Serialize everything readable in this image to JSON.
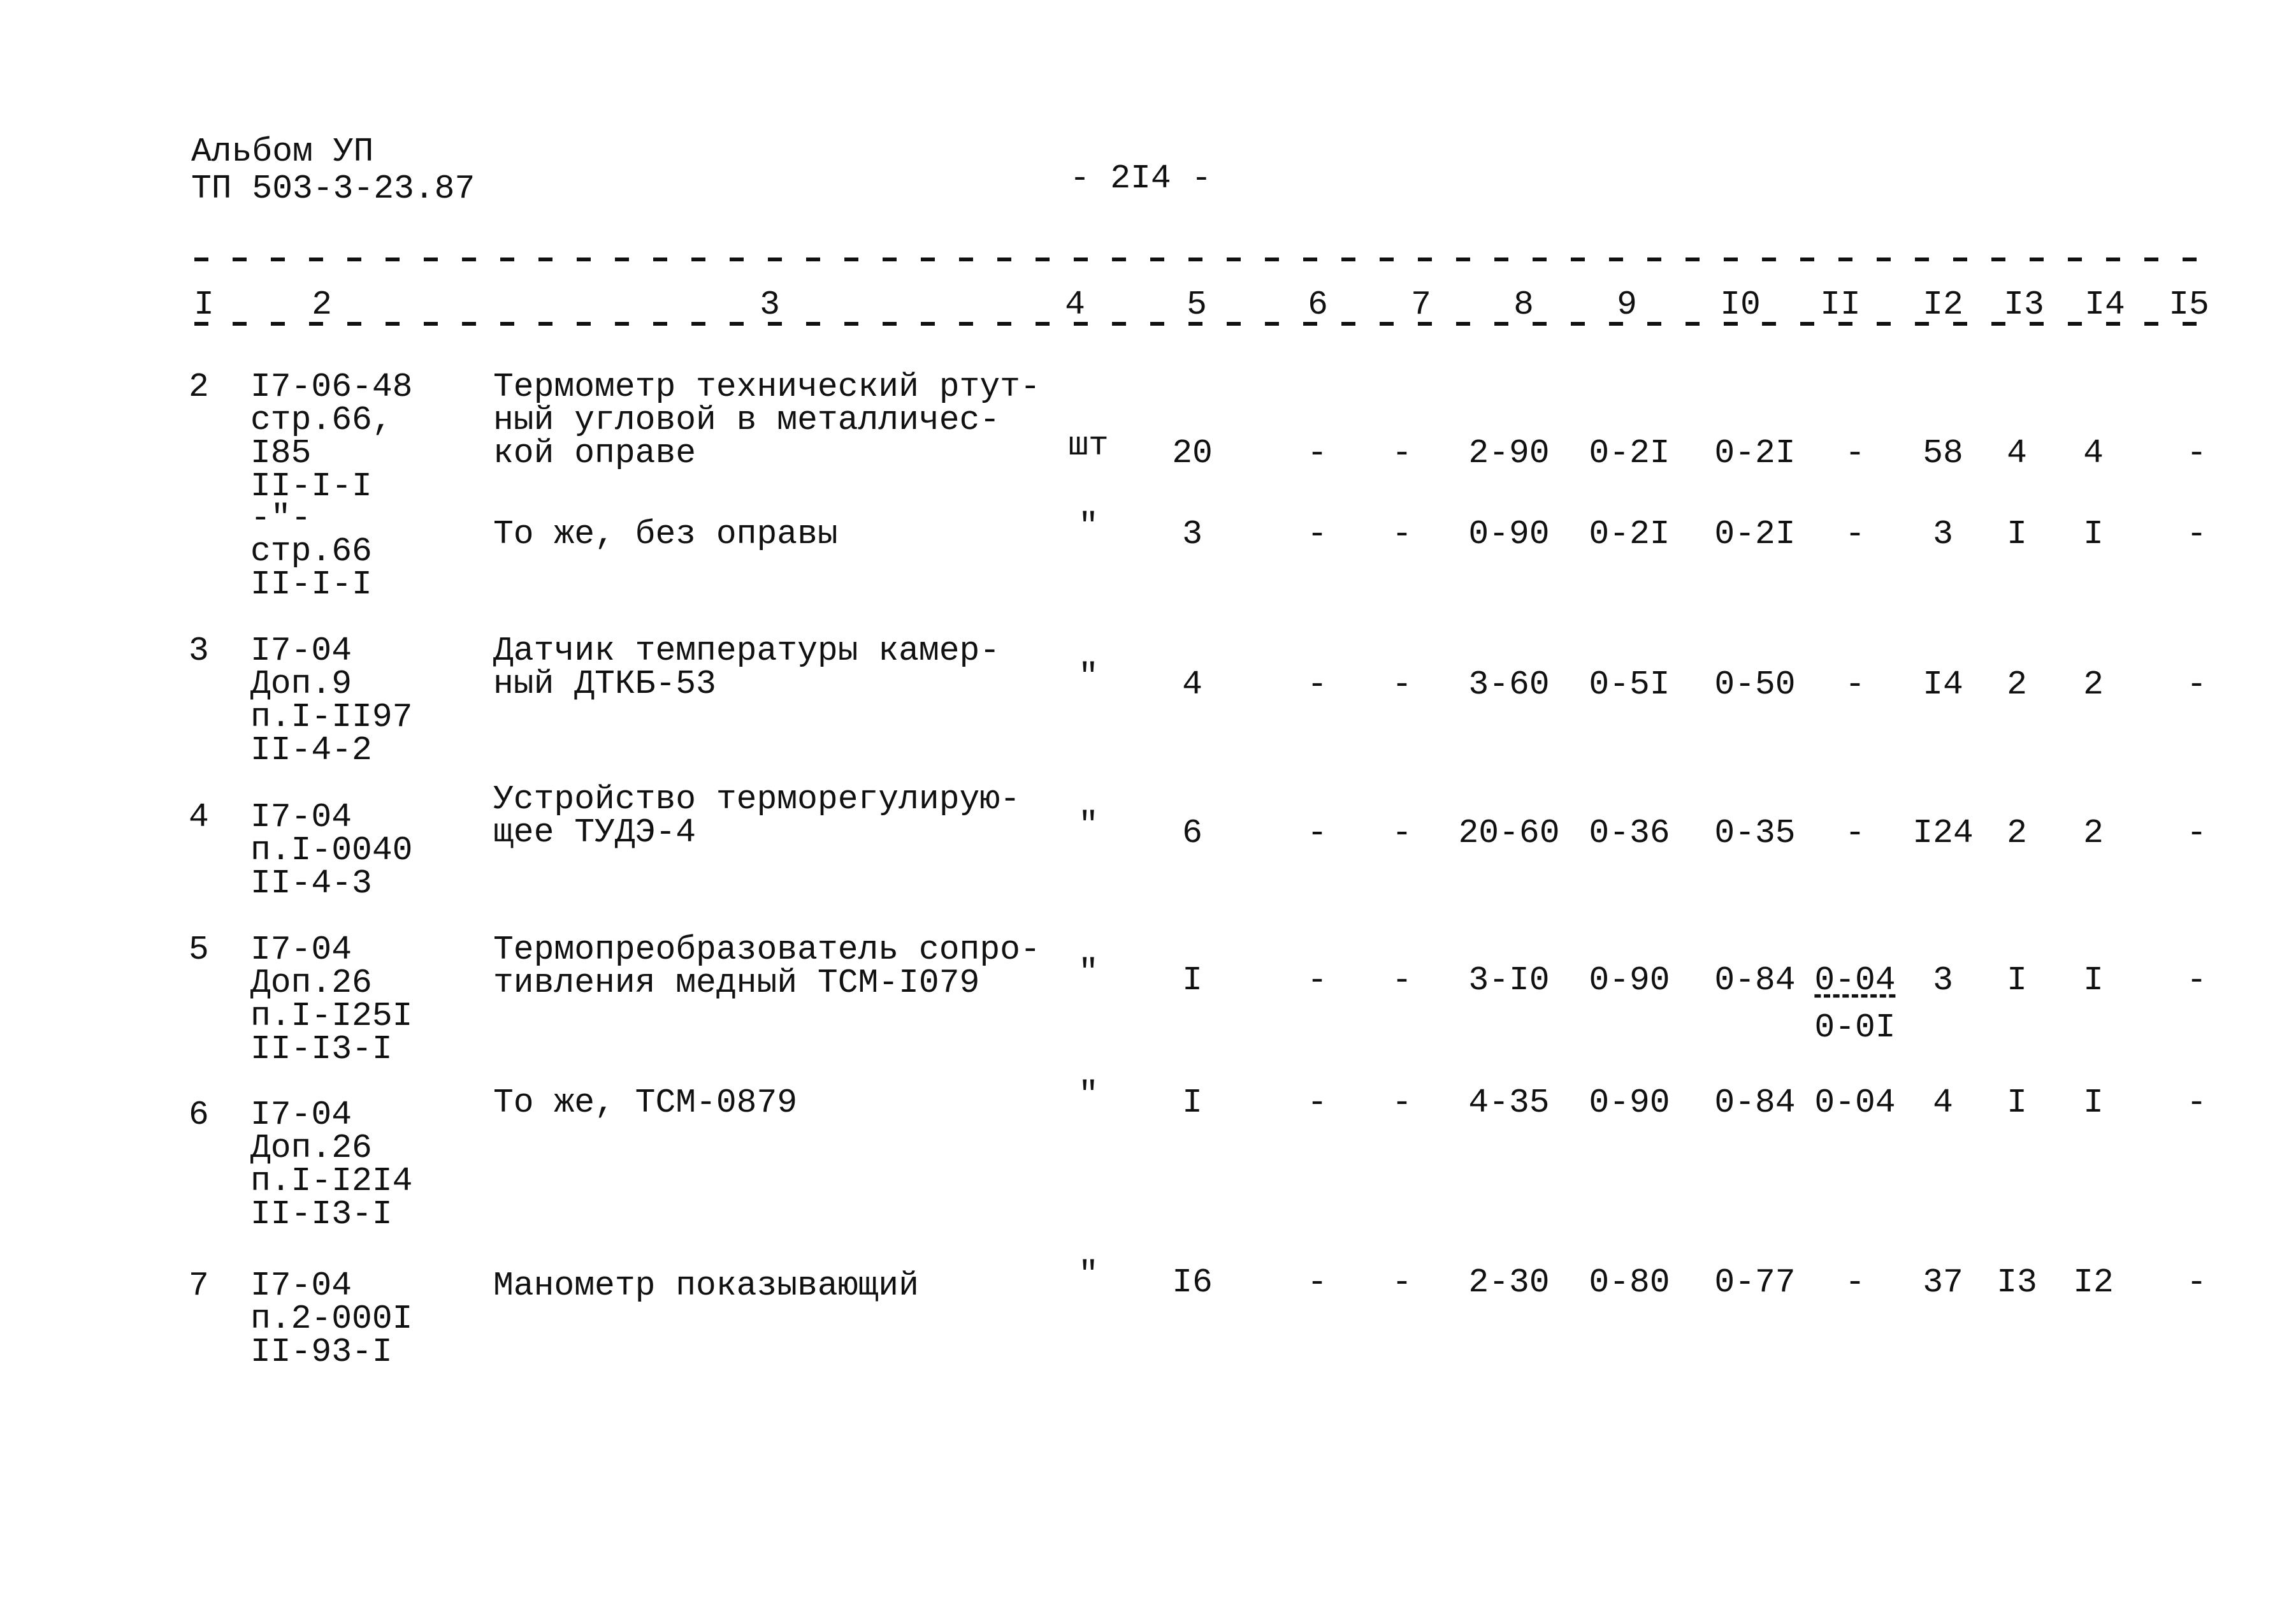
{
  "header": {
    "album": "Альбом УП",
    "doc_code": "ТП 503-3-23.87",
    "page_number": "- 2I4 -"
  },
  "columns": [
    "I",
    "2",
    "3",
    "4",
    "5",
    "6",
    "7",
    "8",
    "9",
    "I0",
    "II",
    "I2",
    "I3",
    "I4",
    "I5"
  ],
  "rows": [
    {
      "num": "2",
      "ref": [
        "I7-06-48",
        "стр.66,",
        "I85",
        "II-I-I"
      ],
      "desc": [
        "Термометр технический ртут-",
        "ный угловой в металличес-",
        "кой оправе"
      ],
      "unit": "шт",
      "c5": "20",
      "c6": "-",
      "c7": "-",
      "c8": "2-90",
      "c9": "0-2I",
      "c10": "0-2I",
      "c11": "-",
      "c12": "58",
      "c13": "4",
      "c14": "4",
      "c15": "-"
    },
    {
      "num": "",
      "ref": [
        "-\"-",
        "стр.66",
        "II-I-I"
      ],
      "desc": [
        "То же, без оправы"
      ],
      "unit": "\"",
      "c5": "3",
      "c6": "-",
      "c7": "-",
      "c8": "0-90",
      "c9": "0-2I",
      "c10": "0-2I",
      "c11": "-",
      "c12": "3",
      "c13": "I",
      "c14": "I",
      "c15": "-"
    },
    {
      "num": "3",
      "ref": [
        "I7-04",
        "Доп.9",
        "п.I-II97",
        "II-4-2"
      ],
      "desc": [
        "Датчик температуры камер-",
        "ный ДТКБ-53"
      ],
      "unit": "\"",
      "c5": "4",
      "c6": "-",
      "c7": "-",
      "c8": "3-60",
      "c9": "0-5I",
      "c10": "0-50",
      "c11": "-",
      "c12": "I4",
      "c13": "2",
      "c14": "2",
      "c15": "-"
    },
    {
      "num": "4",
      "ref": [
        "I7-04",
        "п.I-0040",
        "II-4-3"
      ],
      "desc": [
        "Устройство терморегулирую-",
        "щее ТУДЭ-4"
      ],
      "unit": "\"",
      "c5": "6",
      "c6": "-",
      "c7": "-",
      "c8": "20-60",
      "c9": "0-36",
      "c10": "0-35",
      "c11": "-",
      "c12": "I24",
      "c13": "2",
      "c14": "2",
      "c15": "-"
    },
    {
      "num": "5",
      "ref": [
        "I7-04",
        "Доп.26",
        "п.I-I25I",
        "II-I3-I"
      ],
      "desc": [
        "Термопреобразователь сопро-",
        "тивления медный ТСМ-I079"
      ],
      "unit": "\"",
      "c5": "I",
      "c6": "-",
      "c7": "-",
      "c8": "3-I0",
      "c9": "0-90",
      "c10": "0-84",
      "c11": "0-04",
      "c11_sub": "0-0I",
      "c12": "3",
      "c13": "I",
      "c14": "I",
      "c15": "-"
    },
    {
      "num": "6",
      "ref": [
        "I7-04",
        "Доп.26",
        "п.I-I2I4",
        "II-I3-I"
      ],
      "desc": [
        "То же, ТСМ-0879"
      ],
      "unit": "\"",
      "c5": "I",
      "c6": "-",
      "c7": "-",
      "c8": "4-35",
      "c9": "0-90",
      "c10": "0-84",
      "c11": "0-04",
      "c12": "4",
      "c13": "I",
      "c14": "I",
      "c15": "-"
    },
    {
      "num": "7",
      "ref": [
        "I7-04",
        "п.2-000I",
        "II-93-I"
      ],
      "desc": [
        "Манометр показывающий"
      ],
      "unit": "\"",
      "c5": "I6",
      "c6": "-",
      "c7": "-",
      "c8": "2-30",
      "c9": "0-80",
      "c10": "0-77",
      "c11": "-",
      "c12": "37",
      "c13": "I3",
      "c14": "I2",
      "c15": "-"
    }
  ]
}
